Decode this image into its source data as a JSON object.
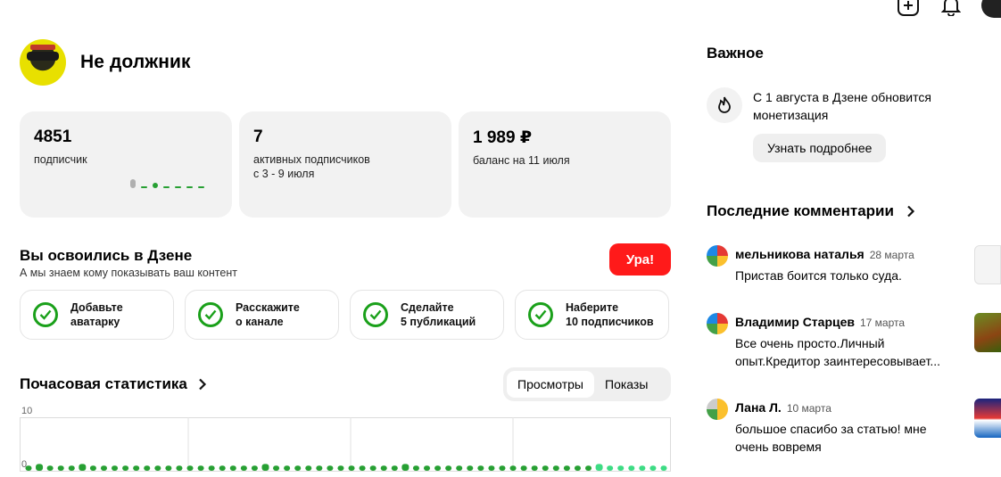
{
  "profile": {
    "name": "Не должник"
  },
  "stats": [
    {
      "value": "4851",
      "label": "подписчик",
      "label2": ""
    },
    {
      "value": "7",
      "label": "активных подписчиков",
      "label2": "с 3 - 9 июля"
    },
    {
      "value": "1 989 ₽",
      "label": "баланс на 11 июля",
      "label2": ""
    }
  ],
  "onboarding": {
    "title": "Вы освоились в Дзене",
    "subtitle": "А мы знаем кому показывать ваш контент",
    "button": "Ура!",
    "tasks": [
      {
        "line1": "Добавьте",
        "line2": "аватарку"
      },
      {
        "line1": "Расскажите",
        "line2": "о канале"
      },
      {
        "line1": "Сделайте",
        "line2": "5 публикаций"
      },
      {
        "line1": "Наберите",
        "line2": "10 подписчиков"
      }
    ]
  },
  "hourly": {
    "title": "Почасовая статистика",
    "tabs": [
      "Просмотры",
      "Показы"
    ],
    "active_tab": "Просмотры",
    "accent": "#27a033"
  },
  "chart_data": {
    "type": "bar",
    "ylim": [
      0,
      10
    ],
    "ytick_labels": [
      "10",
      "0"
    ],
    "values": [
      0.3,
      0.6,
      0.3,
      0.3,
      0.3,
      0.6,
      0.3,
      0.3,
      0.3,
      0.3,
      0.3,
      0.3,
      0.3,
      0.3,
      0.3,
      0.3,
      0.3,
      0.3,
      0.3,
      0.3,
      0.3,
      0.3,
      0.6,
      0.3,
      0.3,
      0.3,
      0.3,
      0.3,
      0.3,
      0.3,
      0.3,
      0.3,
      0.3,
      0.3,
      0.3,
      0.6,
      0.3,
      0.3,
      0.3,
      0.3,
      0.3,
      0.3,
      0.3,
      0.3,
      0.3,
      0.3,
      0.3,
      0.3,
      0.3,
      0.3,
      0.3,
      0.3,
      0.3,
      0.6,
      0.3,
      0.3,
      0.3,
      0.3,
      0.3,
      0.3
    ],
    "colors": {
      "past": "#27a033",
      "recent": "#3ddc84"
    },
    "recent_from_index": 53
  },
  "important": {
    "title": "Важное",
    "news": "С 1 августа в Дзене обновится монетизация",
    "button": "Узнать подробнее"
  },
  "comments": {
    "title": "Последние комментарии",
    "items": [
      {
        "author": "мельникова наталья",
        "date": "28 марта",
        "text": "Пристав боится только суда."
      },
      {
        "author": "Владимир Старцев",
        "date": "17 марта",
        "text": "Все очень просто.Личный опыт.Кредитор заинтересовывает..."
      },
      {
        "author": "Лана Л.",
        "date": "10 марта",
        "text": "большое спасибо за статью! мне очень вовремя"
      }
    ]
  }
}
